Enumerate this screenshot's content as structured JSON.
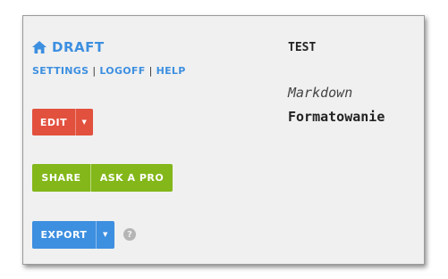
{
  "brand": {
    "icon": "home-icon",
    "label": "DRAFT",
    "color": "#3d8fe0"
  },
  "nav": {
    "settings": "SETTINGS",
    "logoff": "LOGOFF",
    "help": "HELP",
    "separator": "|"
  },
  "edit": {
    "label": "EDIT",
    "caret_icon": "caret-down-icon",
    "color": "#e2513e"
  },
  "share": {
    "share_label": "SHARE",
    "ask_label": "ASK A PRO",
    "color": "#83b71a"
  },
  "export": {
    "label": "EXPORT",
    "caret_icon": "caret-down-icon",
    "help_icon": "question-circle-icon",
    "color": "#3d8fe0"
  },
  "preview": {
    "title": "TEST",
    "italic_text": "Markdown",
    "bold_text": "Formatowanie"
  }
}
